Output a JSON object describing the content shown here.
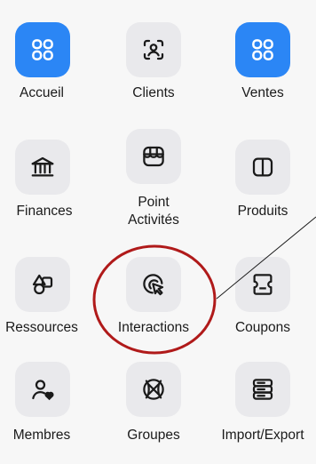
{
  "apps": [
    {
      "id": "accueil",
      "label": "Accueil",
      "icon": "grid-icon",
      "active": true
    },
    {
      "id": "clients",
      "label": "Clients",
      "icon": "user-scan-icon",
      "active": false
    },
    {
      "id": "ventes",
      "label": "Ventes",
      "icon": "grid-icon",
      "active": true
    },
    {
      "id": "finances",
      "label": "Finances",
      "icon": "bank-icon",
      "active": false
    },
    {
      "id": "point-activites",
      "label": "Point Activités",
      "icon": "storefront-icon",
      "active": false
    },
    {
      "id": "produits",
      "label": "Produits",
      "icon": "book-open-icon",
      "active": false
    },
    {
      "id": "ressources",
      "label": "Ressources",
      "icon": "shapes-icon",
      "active": false
    },
    {
      "id": "interactions",
      "label": "Interactions",
      "icon": "cursor-click-icon",
      "active": false
    },
    {
      "id": "coupons",
      "label": "Coupons",
      "icon": "ticket-icon",
      "active": false
    },
    {
      "id": "membres",
      "label": "Membres",
      "icon": "user-heart-icon",
      "active": false
    },
    {
      "id": "groupes",
      "label": "Groupes",
      "icon": "basketball-icon",
      "active": false
    },
    {
      "id": "import-export",
      "label": "Import/Export",
      "icon": "database-icon",
      "active": false
    }
  ],
  "colors": {
    "active_tile": "#2b86f5",
    "inactive_tile": "#e9e9ec",
    "annotation": "#b01a1a",
    "background": "#f7f7f7"
  }
}
